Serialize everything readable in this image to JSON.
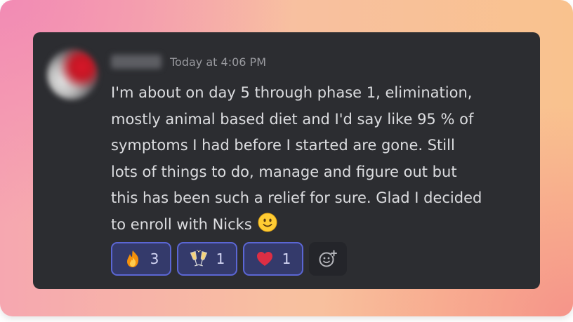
{
  "message": {
    "timestamp": "Today at 4:06 PM",
    "lines": [
      "I'm about on day 5 through phase 1, elimination,",
      "mostly animal based diet and I'd say like 95 % of",
      "symptoms I had before I started are gone. Still",
      "lots of things to do, manage and figure out but",
      "this has been such a relief for sure. Glad I decided",
      "to enroll with Nicks"
    ],
    "inline_emoji": "slightly-smiling-face-icon"
  },
  "reactions": [
    {
      "emoji": "fire-icon",
      "count": "3"
    },
    {
      "emoji": "clinking-glasses-icon",
      "count": "1"
    },
    {
      "emoji": "red-heart-icon",
      "count": "1"
    }
  ],
  "add_reaction_icon": "add-reaction-icon",
  "colors": {
    "card_bg": "#2c2d31",
    "text": "#dcdde0",
    "timestamp": "#9a9ba0",
    "reaction_border": "#5b66d4",
    "reaction_bg": "#343a6b"
  }
}
